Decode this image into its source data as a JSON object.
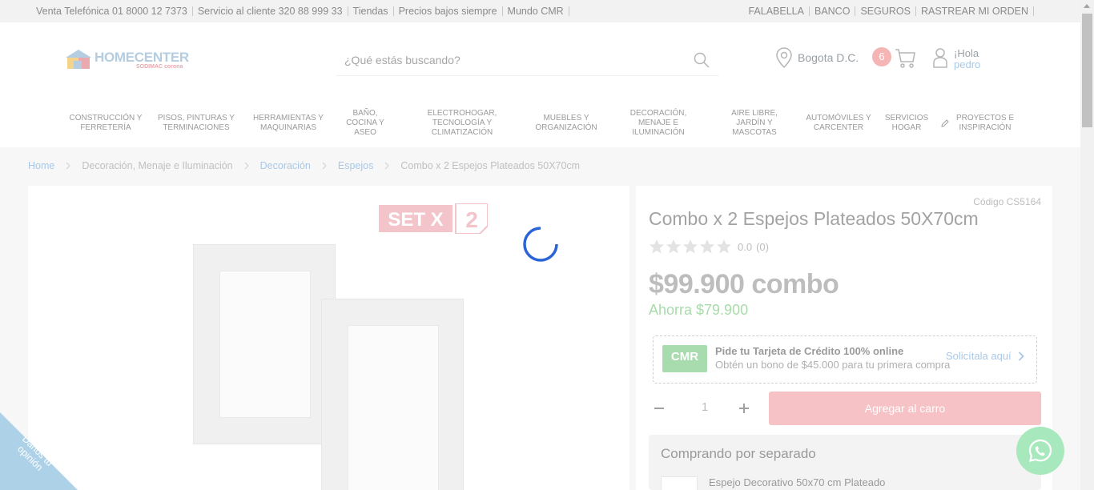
{
  "topbar": {
    "left": [
      {
        "label": "Venta Telefónica",
        "bold": "01 8000 12 7373"
      },
      {
        "label": "Servicio al cliente",
        "bold": "320 88 999 33"
      },
      {
        "label": "Tiendas"
      },
      {
        "label": "Precios bajos siempre"
      },
      {
        "label": "Mundo CMR"
      }
    ],
    "right": [
      "FALABELLA",
      "BANCO",
      "SEGUROS",
      "RASTREAR MI ORDEN"
    ]
  },
  "header": {
    "logo_text": "HOMECENTER",
    "logo_sub": "SODIMAC corona",
    "search_placeholder": "¿Qué estás buscando?",
    "location": "Bogota D.C.",
    "cart_count": "6",
    "greeting": "¡Hola",
    "user_name": "pedro"
  },
  "nav": [
    "CONSTRUCCIÓN Y FERRETERÍA",
    "PISOS, PINTURAS Y TERMINACIONES",
    "HERRAMIENTAS Y MAQUINARIAS",
    "BAÑO, COCINA Y ASEO",
    "ELECTROHOGAR, TECNOLOGÍA Y CLIMATIZACIÓN",
    "MUEBLES Y ORGANIZACIÓN",
    "DECORACIÓN, MENAJE E ILUMINACIÓN",
    "AIRE LIBRE, JARDÍN Y MASCOTAS",
    "AUTOMÓVILES Y CARCENTER",
    "SERVICIOS HOGAR",
    "PROYECTOS E INSPIRACIÓN"
  ],
  "breadcrumb": [
    {
      "label": "Home",
      "link": true
    },
    {
      "label": "Decoración, Menaje e Iluminación",
      "link": false
    },
    {
      "label": "Decoración",
      "link": true
    },
    {
      "label": "Espejos",
      "link": true
    },
    {
      "label": "Combo x 2 Espejos Plateados 50X70cm",
      "link": false
    }
  ],
  "product": {
    "image_badge": "SET X 2",
    "code": "Código CS5164",
    "title": "Combo x 2 Espejos Plateados 50X70cm",
    "rating_value": "0.0",
    "rating_count": "(0)",
    "stars_filled": 0,
    "stars_total": 5,
    "price": "$99.900",
    "price_unit": "combo",
    "savings": "Ahorra $79.900",
    "quantity": "1",
    "add_to_cart": "Agregar al carro"
  },
  "cmr_promo": {
    "logo": "CMR",
    "title": "Pide tu Tarjeta de Crédito 100% online",
    "subtitle": "Obtén un bono de $45.000 para tu primera compra",
    "link": "Solicítala aquí"
  },
  "separately": {
    "title": "Comprando por separado",
    "item_name": "Espejo Decorativo 50x70 cm Plateado"
  },
  "feedback_tab": "Danos tu opinión",
  "colors": {
    "accent_blue": "#a9c8e6",
    "cart_badge": "#f6b5b5",
    "add_to_cart": "#f6c2c6",
    "savings_green": "#a7dcaa",
    "whatsapp": "#a8e8bd"
  }
}
